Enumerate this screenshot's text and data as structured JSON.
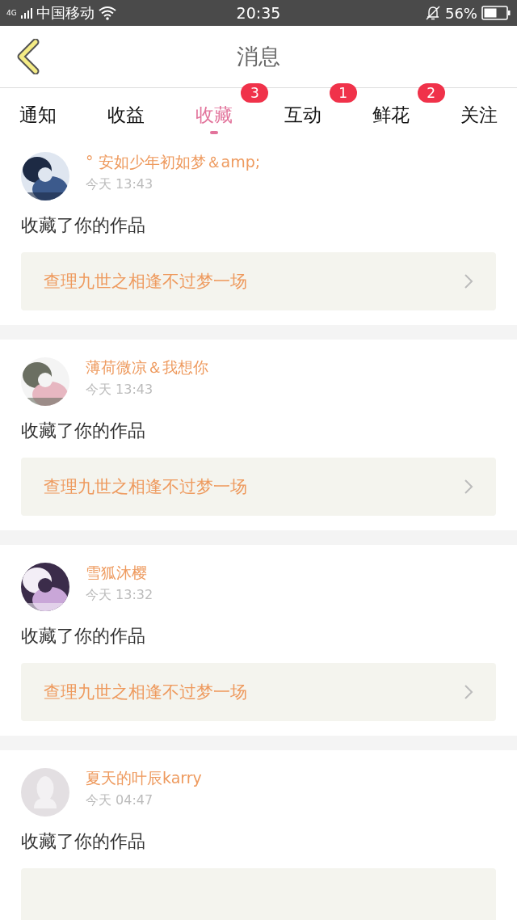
{
  "status_bar": {
    "carrier": "中国移动",
    "network": "4G",
    "time": "20:35",
    "battery": "56%"
  },
  "header": {
    "title": "消息"
  },
  "tabs": [
    {
      "label": "通知",
      "selected": false
    },
    {
      "label": "收益",
      "selected": false
    },
    {
      "label": "收藏",
      "selected": true,
      "badge": "3"
    },
    {
      "label": "互动",
      "selected": false,
      "badge": "1"
    },
    {
      "label": "鲜花",
      "selected": false,
      "badge": "2"
    },
    {
      "label": "关注",
      "selected": false
    }
  ],
  "messages": [
    {
      "name": "° 安如少年初如梦＆amp;",
      "time": "今天 13:43",
      "action": "收藏了你的作品",
      "work": "查理九世之相逢不过梦一场"
    },
    {
      "name": "薄荷微凉＆我想你",
      "time": "今天 13:43",
      "action": "收藏了你的作品",
      "work": "查理九世之相逢不过梦一场"
    },
    {
      "name": "雪狐沐樱",
      "time": "今天 13:32",
      "action": "收藏了你的作品",
      "work": "查理九世之相逢不过梦一场"
    },
    {
      "avatar": {
        "kind": "placeholder"
      },
      "name": "夏天的叶辰karry",
      "time": "今天 04:47",
      "action": "收藏了你的作品"
    }
  ]
}
